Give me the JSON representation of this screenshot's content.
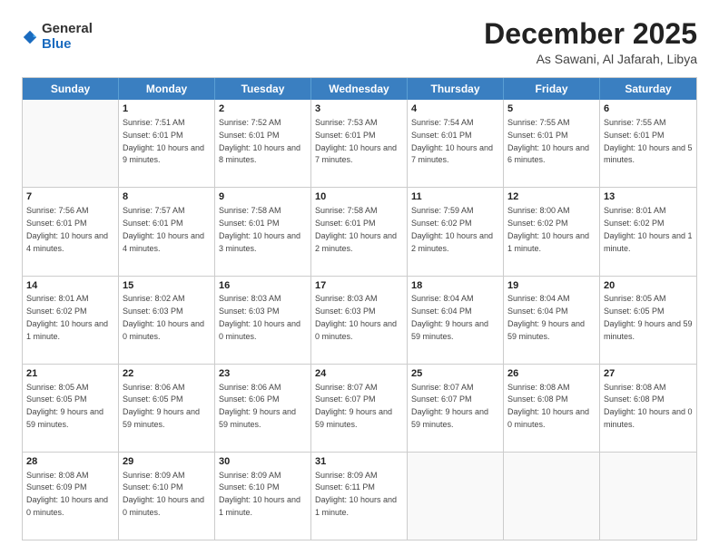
{
  "logo": {
    "general": "General",
    "blue": "Blue"
  },
  "title": "December 2025",
  "subtitle": "As Sawani, Al Jafarah, Libya",
  "header_days": [
    "Sunday",
    "Monday",
    "Tuesday",
    "Wednesday",
    "Thursday",
    "Friday",
    "Saturday"
  ],
  "weeks": [
    [
      {
        "day": "",
        "sunrise": "",
        "sunset": "",
        "daylight": ""
      },
      {
        "day": "1",
        "sunrise": "Sunrise: 7:51 AM",
        "sunset": "Sunset: 6:01 PM",
        "daylight": "Daylight: 10 hours and 9 minutes."
      },
      {
        "day": "2",
        "sunrise": "Sunrise: 7:52 AM",
        "sunset": "Sunset: 6:01 PM",
        "daylight": "Daylight: 10 hours and 8 minutes."
      },
      {
        "day": "3",
        "sunrise": "Sunrise: 7:53 AM",
        "sunset": "Sunset: 6:01 PM",
        "daylight": "Daylight: 10 hours and 7 minutes."
      },
      {
        "day": "4",
        "sunrise": "Sunrise: 7:54 AM",
        "sunset": "Sunset: 6:01 PM",
        "daylight": "Daylight: 10 hours and 7 minutes."
      },
      {
        "day": "5",
        "sunrise": "Sunrise: 7:55 AM",
        "sunset": "Sunset: 6:01 PM",
        "daylight": "Daylight: 10 hours and 6 minutes."
      },
      {
        "day": "6",
        "sunrise": "Sunrise: 7:55 AM",
        "sunset": "Sunset: 6:01 PM",
        "daylight": "Daylight: 10 hours and 5 minutes."
      }
    ],
    [
      {
        "day": "7",
        "sunrise": "Sunrise: 7:56 AM",
        "sunset": "Sunset: 6:01 PM",
        "daylight": "Daylight: 10 hours and 4 minutes."
      },
      {
        "day": "8",
        "sunrise": "Sunrise: 7:57 AM",
        "sunset": "Sunset: 6:01 PM",
        "daylight": "Daylight: 10 hours and 4 minutes."
      },
      {
        "day": "9",
        "sunrise": "Sunrise: 7:58 AM",
        "sunset": "Sunset: 6:01 PM",
        "daylight": "Daylight: 10 hours and 3 minutes."
      },
      {
        "day": "10",
        "sunrise": "Sunrise: 7:58 AM",
        "sunset": "Sunset: 6:01 PM",
        "daylight": "Daylight: 10 hours and 2 minutes."
      },
      {
        "day": "11",
        "sunrise": "Sunrise: 7:59 AM",
        "sunset": "Sunset: 6:02 PM",
        "daylight": "Daylight: 10 hours and 2 minutes."
      },
      {
        "day": "12",
        "sunrise": "Sunrise: 8:00 AM",
        "sunset": "Sunset: 6:02 PM",
        "daylight": "Daylight: 10 hours and 1 minute."
      },
      {
        "day": "13",
        "sunrise": "Sunrise: 8:01 AM",
        "sunset": "Sunset: 6:02 PM",
        "daylight": "Daylight: 10 hours and 1 minute."
      }
    ],
    [
      {
        "day": "14",
        "sunrise": "Sunrise: 8:01 AM",
        "sunset": "Sunset: 6:02 PM",
        "daylight": "Daylight: 10 hours and 1 minute."
      },
      {
        "day": "15",
        "sunrise": "Sunrise: 8:02 AM",
        "sunset": "Sunset: 6:03 PM",
        "daylight": "Daylight: 10 hours and 0 minutes."
      },
      {
        "day": "16",
        "sunrise": "Sunrise: 8:03 AM",
        "sunset": "Sunset: 6:03 PM",
        "daylight": "Daylight: 10 hours and 0 minutes."
      },
      {
        "day": "17",
        "sunrise": "Sunrise: 8:03 AM",
        "sunset": "Sunset: 6:03 PM",
        "daylight": "Daylight: 10 hours and 0 minutes."
      },
      {
        "day": "18",
        "sunrise": "Sunrise: 8:04 AM",
        "sunset": "Sunset: 6:04 PM",
        "daylight": "Daylight: 9 hours and 59 minutes."
      },
      {
        "day": "19",
        "sunrise": "Sunrise: 8:04 AM",
        "sunset": "Sunset: 6:04 PM",
        "daylight": "Daylight: 9 hours and 59 minutes."
      },
      {
        "day": "20",
        "sunrise": "Sunrise: 8:05 AM",
        "sunset": "Sunset: 6:05 PM",
        "daylight": "Daylight: 9 hours and 59 minutes."
      }
    ],
    [
      {
        "day": "21",
        "sunrise": "Sunrise: 8:05 AM",
        "sunset": "Sunset: 6:05 PM",
        "daylight": "Daylight: 9 hours and 59 minutes."
      },
      {
        "day": "22",
        "sunrise": "Sunrise: 8:06 AM",
        "sunset": "Sunset: 6:05 PM",
        "daylight": "Daylight: 9 hours and 59 minutes."
      },
      {
        "day": "23",
        "sunrise": "Sunrise: 8:06 AM",
        "sunset": "Sunset: 6:06 PM",
        "daylight": "Daylight: 9 hours and 59 minutes."
      },
      {
        "day": "24",
        "sunrise": "Sunrise: 8:07 AM",
        "sunset": "Sunset: 6:07 PM",
        "daylight": "Daylight: 9 hours and 59 minutes."
      },
      {
        "day": "25",
        "sunrise": "Sunrise: 8:07 AM",
        "sunset": "Sunset: 6:07 PM",
        "daylight": "Daylight: 9 hours and 59 minutes."
      },
      {
        "day": "26",
        "sunrise": "Sunrise: 8:08 AM",
        "sunset": "Sunset: 6:08 PM",
        "daylight": "Daylight: 10 hours and 0 minutes."
      },
      {
        "day": "27",
        "sunrise": "Sunrise: 8:08 AM",
        "sunset": "Sunset: 6:08 PM",
        "daylight": "Daylight: 10 hours and 0 minutes."
      }
    ],
    [
      {
        "day": "28",
        "sunrise": "Sunrise: 8:08 AM",
        "sunset": "Sunset: 6:09 PM",
        "daylight": "Daylight: 10 hours and 0 minutes."
      },
      {
        "day": "29",
        "sunrise": "Sunrise: 8:09 AM",
        "sunset": "Sunset: 6:10 PM",
        "daylight": "Daylight: 10 hours and 0 minutes."
      },
      {
        "day": "30",
        "sunrise": "Sunrise: 8:09 AM",
        "sunset": "Sunset: 6:10 PM",
        "daylight": "Daylight: 10 hours and 1 minute."
      },
      {
        "day": "31",
        "sunrise": "Sunrise: 8:09 AM",
        "sunset": "Sunset: 6:11 PM",
        "daylight": "Daylight: 10 hours and 1 minute."
      },
      {
        "day": "",
        "sunrise": "",
        "sunset": "",
        "daylight": ""
      },
      {
        "day": "",
        "sunrise": "",
        "sunset": "",
        "daylight": ""
      },
      {
        "day": "",
        "sunrise": "",
        "sunset": "",
        "daylight": ""
      }
    ]
  ]
}
